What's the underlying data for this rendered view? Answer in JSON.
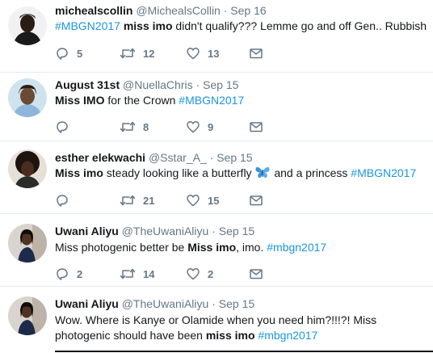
{
  "tweets": [
    {
      "name": "michealscollin",
      "handle": "@MichealsCollin",
      "separator": "·",
      "date": "Sep 16",
      "text_parts": [
        {
          "t": "#MBGN2017",
          "k": "hashtag"
        },
        {
          "t": " ",
          "k": "plain"
        },
        {
          "t": "miss imo",
          "k": "bold"
        },
        {
          "t": " didn't qualify???  Lemme go and off Gen.. Rubbish",
          "k": "plain"
        }
      ],
      "replies": "5",
      "retweets": "12",
      "likes": "13"
    },
    {
      "name": "August 31st",
      "handle": "@NuellaChris",
      "separator": "·",
      "date": "Sep 15",
      "text_parts": [
        {
          "t": "Miss IMO",
          "k": "bold"
        },
        {
          "t": " for the Crown ",
          "k": "plain"
        },
        {
          "t": "#MBGN2017",
          "k": "hashtag"
        }
      ],
      "replies": "",
      "retweets": "8",
      "likes": "9"
    },
    {
      "name": "esther elekwachi",
      "handle": "@Sstar_A_",
      "separator": "·",
      "date": "Sep 15",
      "text_parts": [
        {
          "t": "Miss imo",
          "k": "bold"
        },
        {
          "t": " steady looking like a butterfly ",
          "k": "plain"
        },
        {
          "t": "butterfly-emoji",
          "k": "emoji"
        },
        {
          "t": " and a princess ",
          "k": "plain"
        },
        {
          "t": "#MBGN2017",
          "k": "hashtag"
        }
      ],
      "replies": "",
      "retweets": "21",
      "likes": "15"
    },
    {
      "name": "Uwani Aliyu",
      "handle": "@TheUwaniAliyu",
      "separator": "·",
      "date": "Sep 15",
      "text_parts": [
        {
          "t": "Miss photogenic better be ",
          "k": "plain"
        },
        {
          "t": "Miss imo",
          "k": "bold"
        },
        {
          "t": ", imo. ",
          "k": "plain"
        },
        {
          "t": "#mbgn2017",
          "k": "hashtag"
        }
      ],
      "replies": "2",
      "retweets": "14",
      "likes": "2"
    },
    {
      "name": "Uwani Aliyu",
      "handle": "@TheUwaniAliyu",
      "separator": "·",
      "date": "Sep 15",
      "text_parts": [
        {
          "t": "Wow. Where is Kanye or Olamide when you need him?!!!?! Miss photogenic should have been ",
          "k": "plain"
        },
        {
          "t": "miss imo",
          "k": "bold"
        },
        {
          "t": " ",
          "k": "plain"
        },
        {
          "t": "#mbgn2017",
          "k": "hashtag"
        }
      ],
      "replies": "",
      "retweets": "",
      "likes": ""
    }
  ],
  "icons": {
    "reply": "reply-icon",
    "retweet": "retweet-icon",
    "like": "heart-icon",
    "dm": "envelope-icon"
  },
  "colors": {
    "hashtag": "#1b95e0",
    "muted": "#657786",
    "text": "#14171a"
  }
}
